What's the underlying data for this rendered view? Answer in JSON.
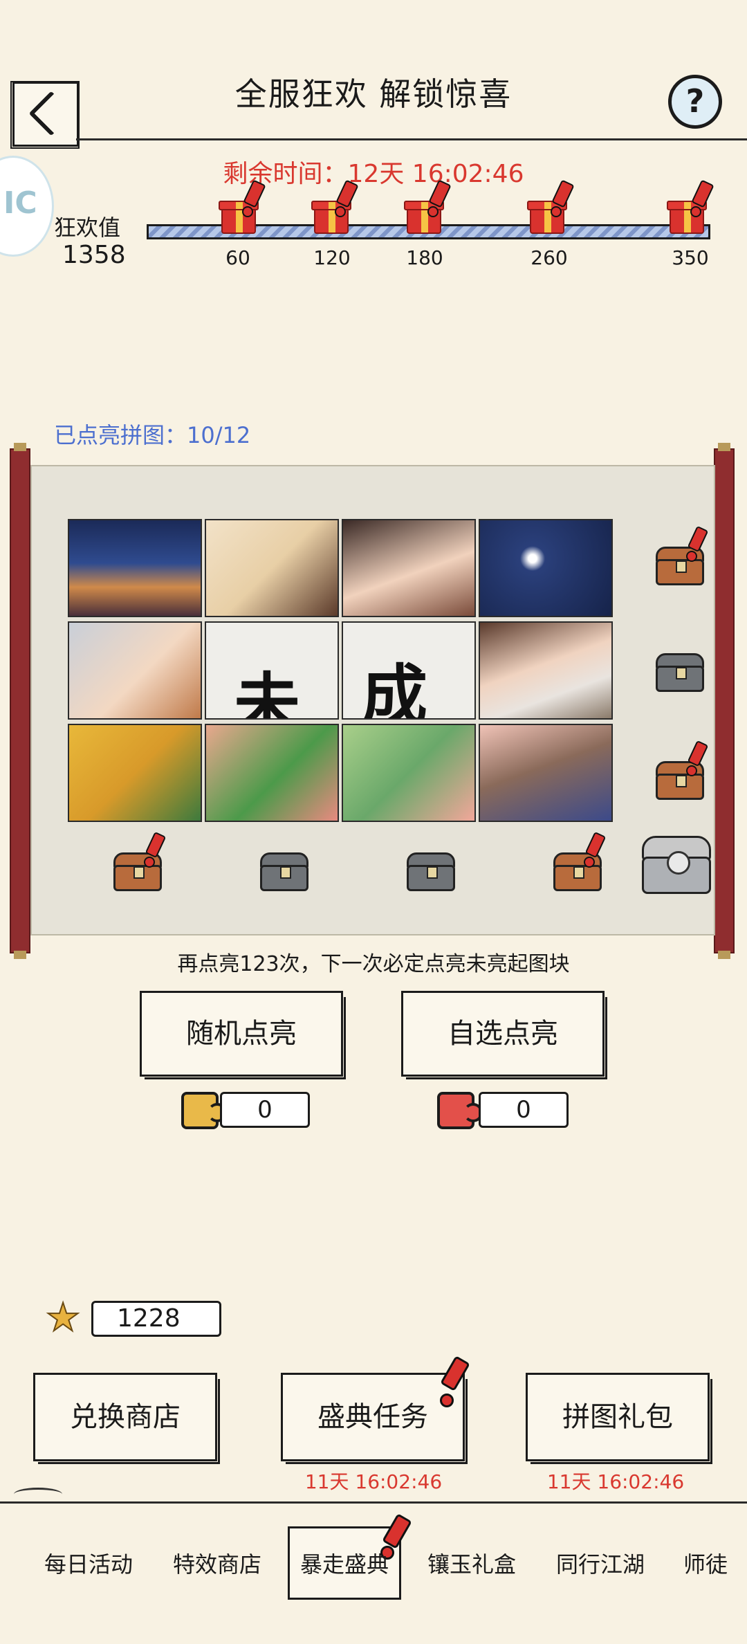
{
  "header": {
    "title": "全服狂欢 解锁惊喜",
    "help_glyph": "?",
    "side_badge": "IC"
  },
  "timer": {
    "text": "剩余时间：12天 16:02:46"
  },
  "carnival": {
    "label": "狂欢值",
    "value": "1358",
    "progress": 1.0,
    "milestones": [
      "60",
      "120",
      "180",
      "260",
      "350"
    ]
  },
  "puzzle": {
    "lit_count": "已点亮拼图：10/12",
    "unlit_chars": [
      "未",
      "成"
    ],
    "hint": "再点亮123次，下一次必定点亮未亮起图块"
  },
  "actions": {
    "random_light": "随机点亮",
    "choose_light": "自选点亮",
    "random_count": "0",
    "choose_count": "0"
  },
  "currency": {
    "value": "1228"
  },
  "buttons": {
    "exchange_shop": "兑换商店",
    "ceremony_tasks": "盛典任务",
    "puzzle_pack": "拼图礼包",
    "tasks_deadline": "11天 16:02:46",
    "pack_deadline": "11天 16:02:46"
  },
  "nav": {
    "items": [
      "每日活动",
      "特效商店",
      "暴走盛典",
      "镶玉礼盒",
      "同行江湖",
      "师徒"
    ],
    "active_index": 2
  },
  "colors": {
    "background": "#f8f2e3",
    "accent_red": "#d9382f",
    "link_blue": "#4c6fcf",
    "scroll_red": "#8f2d2f"
  }
}
